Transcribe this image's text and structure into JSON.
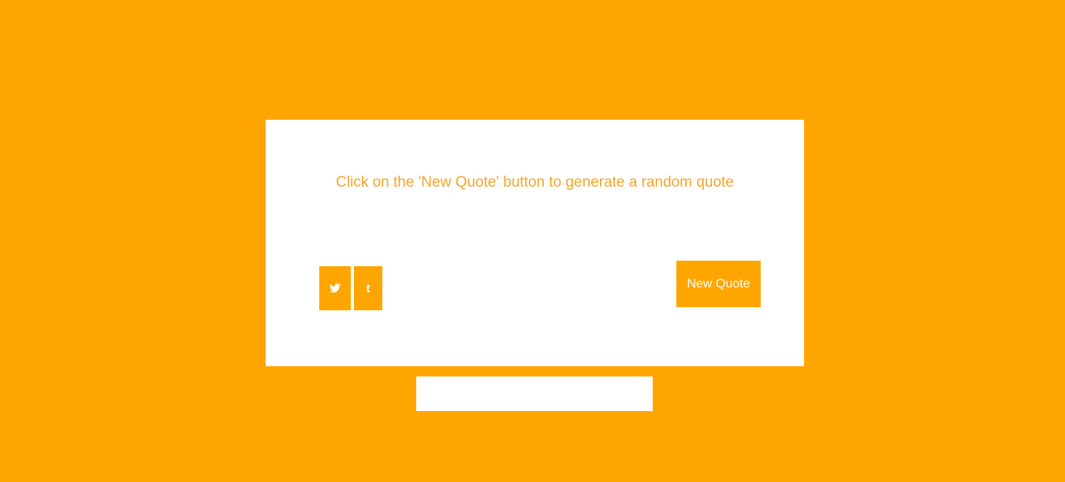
{
  "colors": {
    "background": "#FFA500",
    "card": "#FFFFFF",
    "quote_text": "#F5A52A",
    "button": "#FFA500",
    "button_text": "#FFFFFF"
  },
  "quote": {
    "text": "Click on the 'New Quote' button to generate a random quote"
  },
  "share": {
    "twitter_icon": "twitter-icon",
    "tumblr_icon": "tumblr-icon",
    "tumblr_glyph": "t"
  },
  "actions": {
    "new_quote_label": "New Quote"
  }
}
